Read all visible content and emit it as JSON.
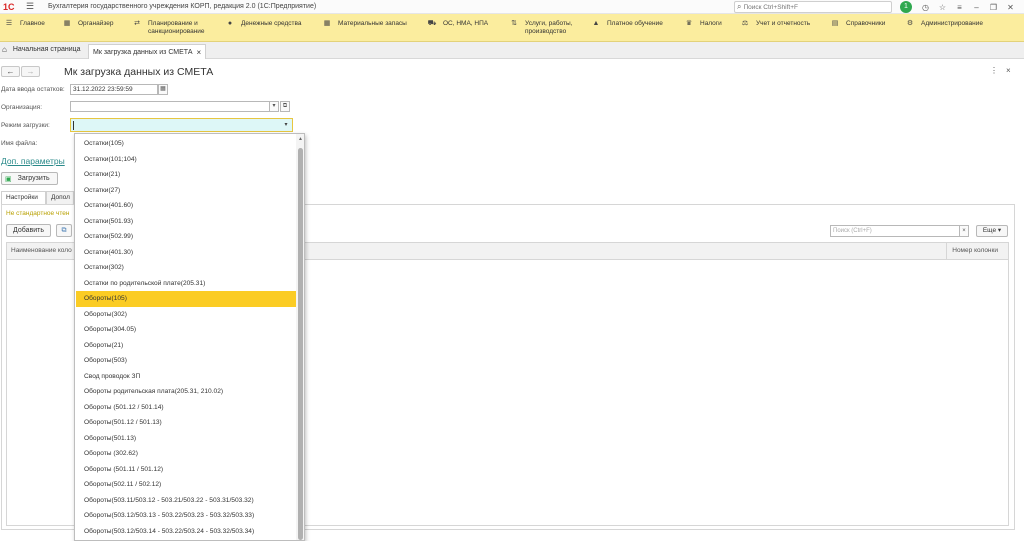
{
  "window": {
    "logo": "1С",
    "title": "Бухгалтерия государственного учреждения КОРП, редакция 2.0  (1С:Предприятие)",
    "search_placeholder": "Поиск Ctrl+Shift+F",
    "notification_count": "1"
  },
  "menu": [
    {
      "icon": "☰",
      "label": "Главное"
    },
    {
      "icon": "▦",
      "label": "Органайзер"
    },
    {
      "icon": "⇄",
      "label": "Планирование и\nсанкционирование"
    },
    {
      "icon": "●",
      "label": "Денежные средства"
    },
    {
      "icon": "▦",
      "label": "Материальные запасы"
    },
    {
      "icon": "⛟",
      "label": "ОС, НМА, НПА"
    },
    {
      "icon": "⇅",
      "label": "Услуги, работы,\nпроизводство"
    },
    {
      "icon": "▲",
      "label": "Платное обучение"
    },
    {
      "icon": "♛",
      "label": "Налоги"
    },
    {
      "icon": "⚖",
      "label": "Учет и отчетность"
    },
    {
      "icon": "▤",
      "label": "Справочники"
    },
    {
      "icon": "⚙",
      "label": "Администрирование"
    }
  ],
  "tabs": {
    "home": "Начальная страница",
    "active": "Мк загрузка данных из СМЕТА"
  },
  "form": {
    "title": "Мк загрузка данных из СМЕТА",
    "date_label": "Дата ввода остатков:",
    "date_value": "31.12.2022 23:59:59",
    "org_label": "Организация:",
    "org_value": "",
    "mode_label": "Режим загрузки:",
    "mode_value": "",
    "file_label": "Имя файла:",
    "extra_params_link": "Доп. параметры",
    "load_button": "Загрузить",
    "subtab_settings": "Настройки",
    "subtab_additional": "Допол",
    "warning_text": "Не стандартное чтен",
    "add_button": "Добавить",
    "table_search_placeholder": "Поиск (Ctrl+F)",
    "more_button": "Еще",
    "col_name": "Наименование коло",
    "col_number": "Номер колонки"
  },
  "dropdown": {
    "selected_index": 10,
    "items": [
      "Остатки(105)",
      "Остатки(101;104)",
      "Остатки(21)",
      "Остатки(27)",
      "Остатки(401.60)",
      "Остатки(501.93)",
      "Остатки(502.99)",
      "Остатки(401.30)",
      "Остатки(302)",
      "Остатки по родительской плате(205.31)",
      "Обороты(105)",
      "Обороты(302)",
      "Обороты(304.05)",
      "Обороты(21)",
      "Обороты(503)",
      "Свод проводок ЗП",
      "Обороты родительская плата(205.31, 210.02)",
      "Обороты (501.12 / 501.14)",
      "Обороты(501.12 / 501.13)",
      "Обороты(501.13)",
      "Обороты (302.62)",
      "Обороты (501.11 / 501.12)",
      "Обороты(502.11 / 502.12)",
      "Обороты(503.11/503.12 - 503.21/503.22 - 503.31/503.32)",
      "Обороты(503.12/503.13 - 503.22/503.23 - 503.32/503.33)",
      "Обороты(503.12/503.14 - 503.22/503.24 - 503.32/503.34)"
    ]
  }
}
